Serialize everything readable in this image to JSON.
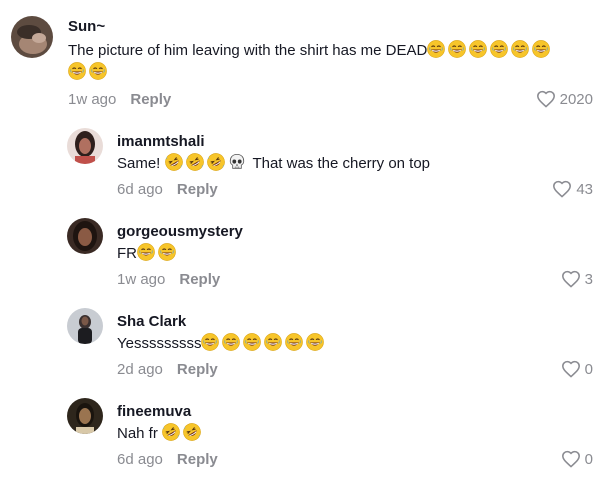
{
  "comments": [
    {
      "username": "Sun~",
      "text": "The picture of him leaving with the shirt has me DEAD",
      "emojis_line1": "grin,grin,grin,grin,grin,grin",
      "time": "1w ago",
      "reply": "Reply",
      "likes": "2020",
      "avatar_colors": [
        "#6e5a4e",
        "#b8a090"
      ]
    },
    {
      "username": "imanmtshali",
      "text_prefix": "Same!",
      "text_suffix": "That was the cherry on top",
      "time": "6d ago",
      "reply": "Reply",
      "likes": "43",
      "avatar_colors": [
        "#3b2a28",
        "#c07a70"
      ]
    },
    {
      "username": "gorgeousmystery",
      "text": "FR",
      "time": "1w ago",
      "reply": "Reply",
      "likes": "3",
      "avatar_colors": [
        "#2a1c18",
        "#7a5040"
      ]
    },
    {
      "username": "Sha Clark",
      "text": "Yesssssssss",
      "time": "2d ago",
      "reply": "Reply",
      "likes": "0",
      "avatar_colors": [
        "#5a6270",
        "#c0c4cc"
      ]
    },
    {
      "username": "fineemuva",
      "text": "Nah fr",
      "time": "6d ago",
      "reply": "Reply",
      "likes": "0",
      "avatar_colors": [
        "#3a3020",
        "#b09060"
      ]
    }
  ],
  "icons": {
    "like": "heart-outline-icon",
    "laugh": "grinning-sweat-emoji",
    "rofl": "rolling-laughing-emoji",
    "skull": "skull-emoji"
  }
}
